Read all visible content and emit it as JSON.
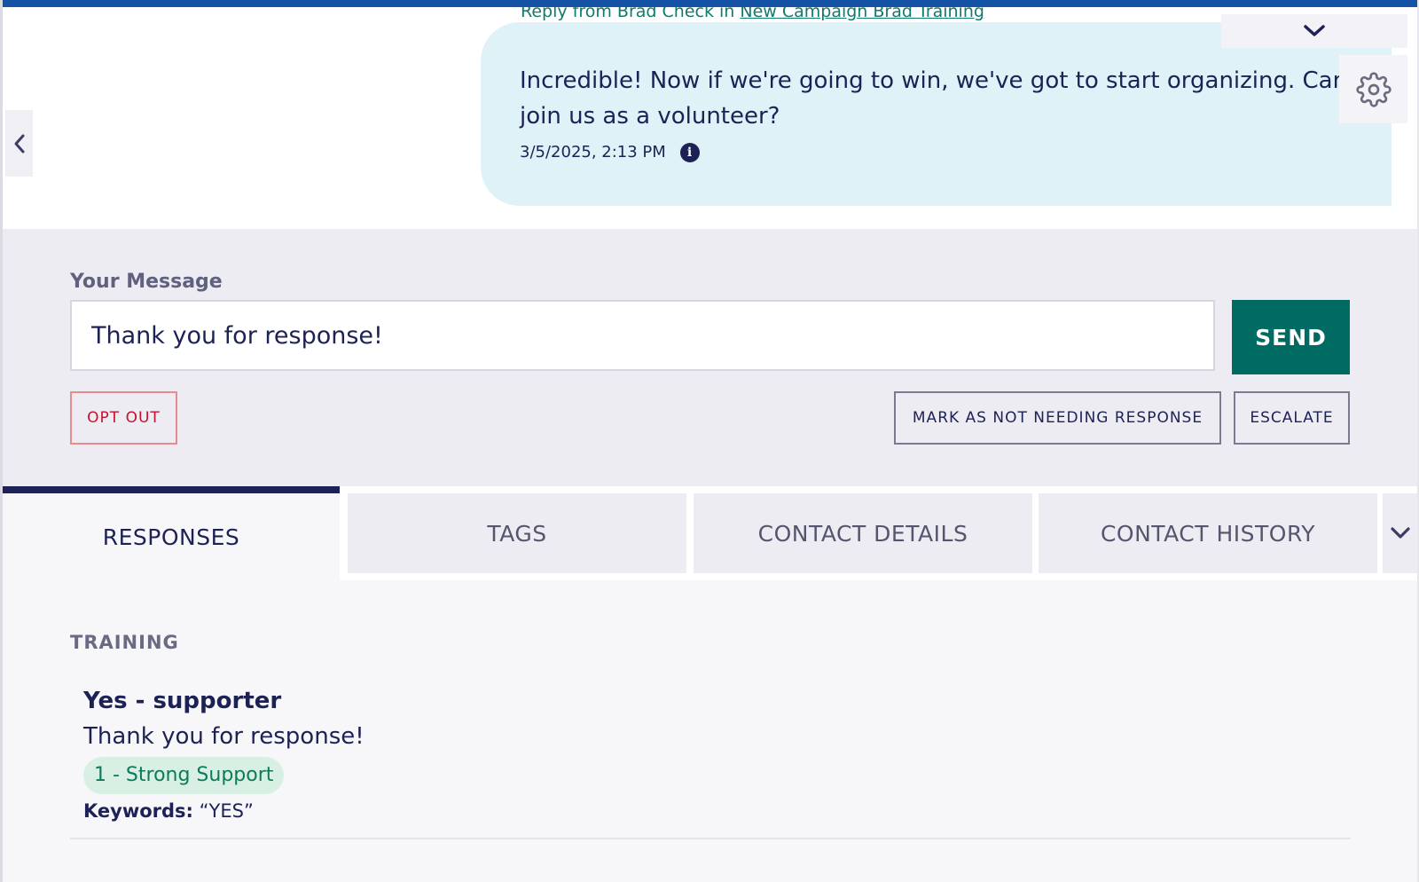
{
  "conversation": {
    "reply_prefix": "Reply from Brad Check in ",
    "reply_campaign_link": "New Campaign Brad Training",
    "message_text": "Incredible! Now if we're going to win, we've got to start organizing. Can you join us as a volunteer?",
    "message_timestamp": "3/5/2025, 2:13 PM",
    "info_icon": "info-icon",
    "settings_icon": "gear-icon",
    "collapse_icon": "chevron-down-icon",
    "back_icon": "chevron-left-icon"
  },
  "compose": {
    "label": "Your Message",
    "input_value": "Thank you for response!",
    "send_label": "SEND",
    "opt_out_label": "OPT OUT",
    "mark_label": "MARK AS NOT NEEDING RESPONSE",
    "escalate_label": "ESCALATE"
  },
  "tabs": [
    {
      "label": "RESPONSES",
      "active": true
    },
    {
      "label": "TAGS",
      "active": false
    },
    {
      "label": "CONTACT DETAILS",
      "active": false
    },
    {
      "label": "CONTACT HISTORY",
      "active": false
    }
  ],
  "tabs_more_icon": "chevron-down-icon",
  "responses": {
    "section_title": "TRAINING",
    "items": [
      {
        "title": "Yes - supporter",
        "text": "Thank you for response!",
        "tag": "1 - Strong Support",
        "keywords_label": "Keywords:",
        "keywords_value": "“YES”"
      }
    ]
  },
  "colors": {
    "top_bar": "#1452a6",
    "send_button": "#006b62",
    "opt_out": "#c8102e",
    "bubble": "#dff2f7",
    "tag_bg": "#d8f0e4",
    "text_primary": "#1d2256"
  }
}
